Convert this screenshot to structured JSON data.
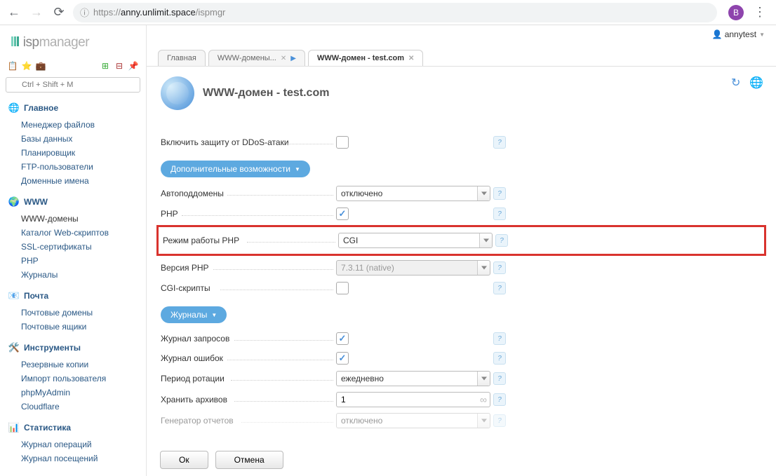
{
  "browser": {
    "url_scheme": "https://",
    "url_host": "anny.unlimit.space",
    "url_path": "/ispmgr",
    "avatar_letter": "B"
  },
  "logo": {
    "isp": "isp",
    "manager": "manager"
  },
  "search": {
    "placeholder": "Ctrl + Shift + M"
  },
  "user": {
    "name": "annytest"
  },
  "nav": {
    "main": {
      "title": "Главное",
      "items": [
        "Менеджер файлов",
        "Базы данных",
        "Планировщик",
        "FTP-пользователи",
        "Доменные имена"
      ]
    },
    "www": {
      "title": "WWW",
      "items": [
        "WWW-домены",
        "Каталог Web-скриптов",
        "SSL-сертификаты",
        "PHP",
        "Журналы"
      ]
    },
    "mail": {
      "title": "Почта",
      "items": [
        "Почтовые домены",
        "Почтовые ящики"
      ]
    },
    "tools": {
      "title": "Инструменты",
      "items": [
        "Резервные копии",
        "Импорт пользователя",
        "phpMyAdmin",
        "Cloudflare"
      ]
    },
    "stats": {
      "title": "Статистика",
      "items": [
        "Журнал операций",
        "Журнал посещений"
      ]
    }
  },
  "tabs": {
    "home": "Главная",
    "list": "WWW-домены...",
    "current": "WWW-домен - test.com"
  },
  "page": {
    "title": "WWW-домен - test.com"
  },
  "sections": {
    "extra": "Дополнительные возможности",
    "logs": "Журналы"
  },
  "form": {
    "ddos_label": "Включить защиту от DDoS-атаки",
    "autosub_label": "Автоподдомены",
    "autosub_value": "отключено",
    "php_label": "PHP",
    "phpmode_label": "Режим работы PHP",
    "phpmode_value": "CGI",
    "phpver_label": "Версия PHP",
    "phpver_value": "7.3.11 (native)",
    "cgi_label": "CGI-скрипты",
    "reqlog_label": "Журнал запросов",
    "errlog_label": "Журнал ошибок",
    "rotate_label": "Период ротации",
    "rotate_value": "ежедневно",
    "archives_label": "Хранить архивов",
    "archives_value": "1",
    "reportgen_label": "Генератор отчетов",
    "reportgen_value": "отключено"
  },
  "buttons": {
    "ok": "Ок",
    "cancel": "Отмена"
  }
}
